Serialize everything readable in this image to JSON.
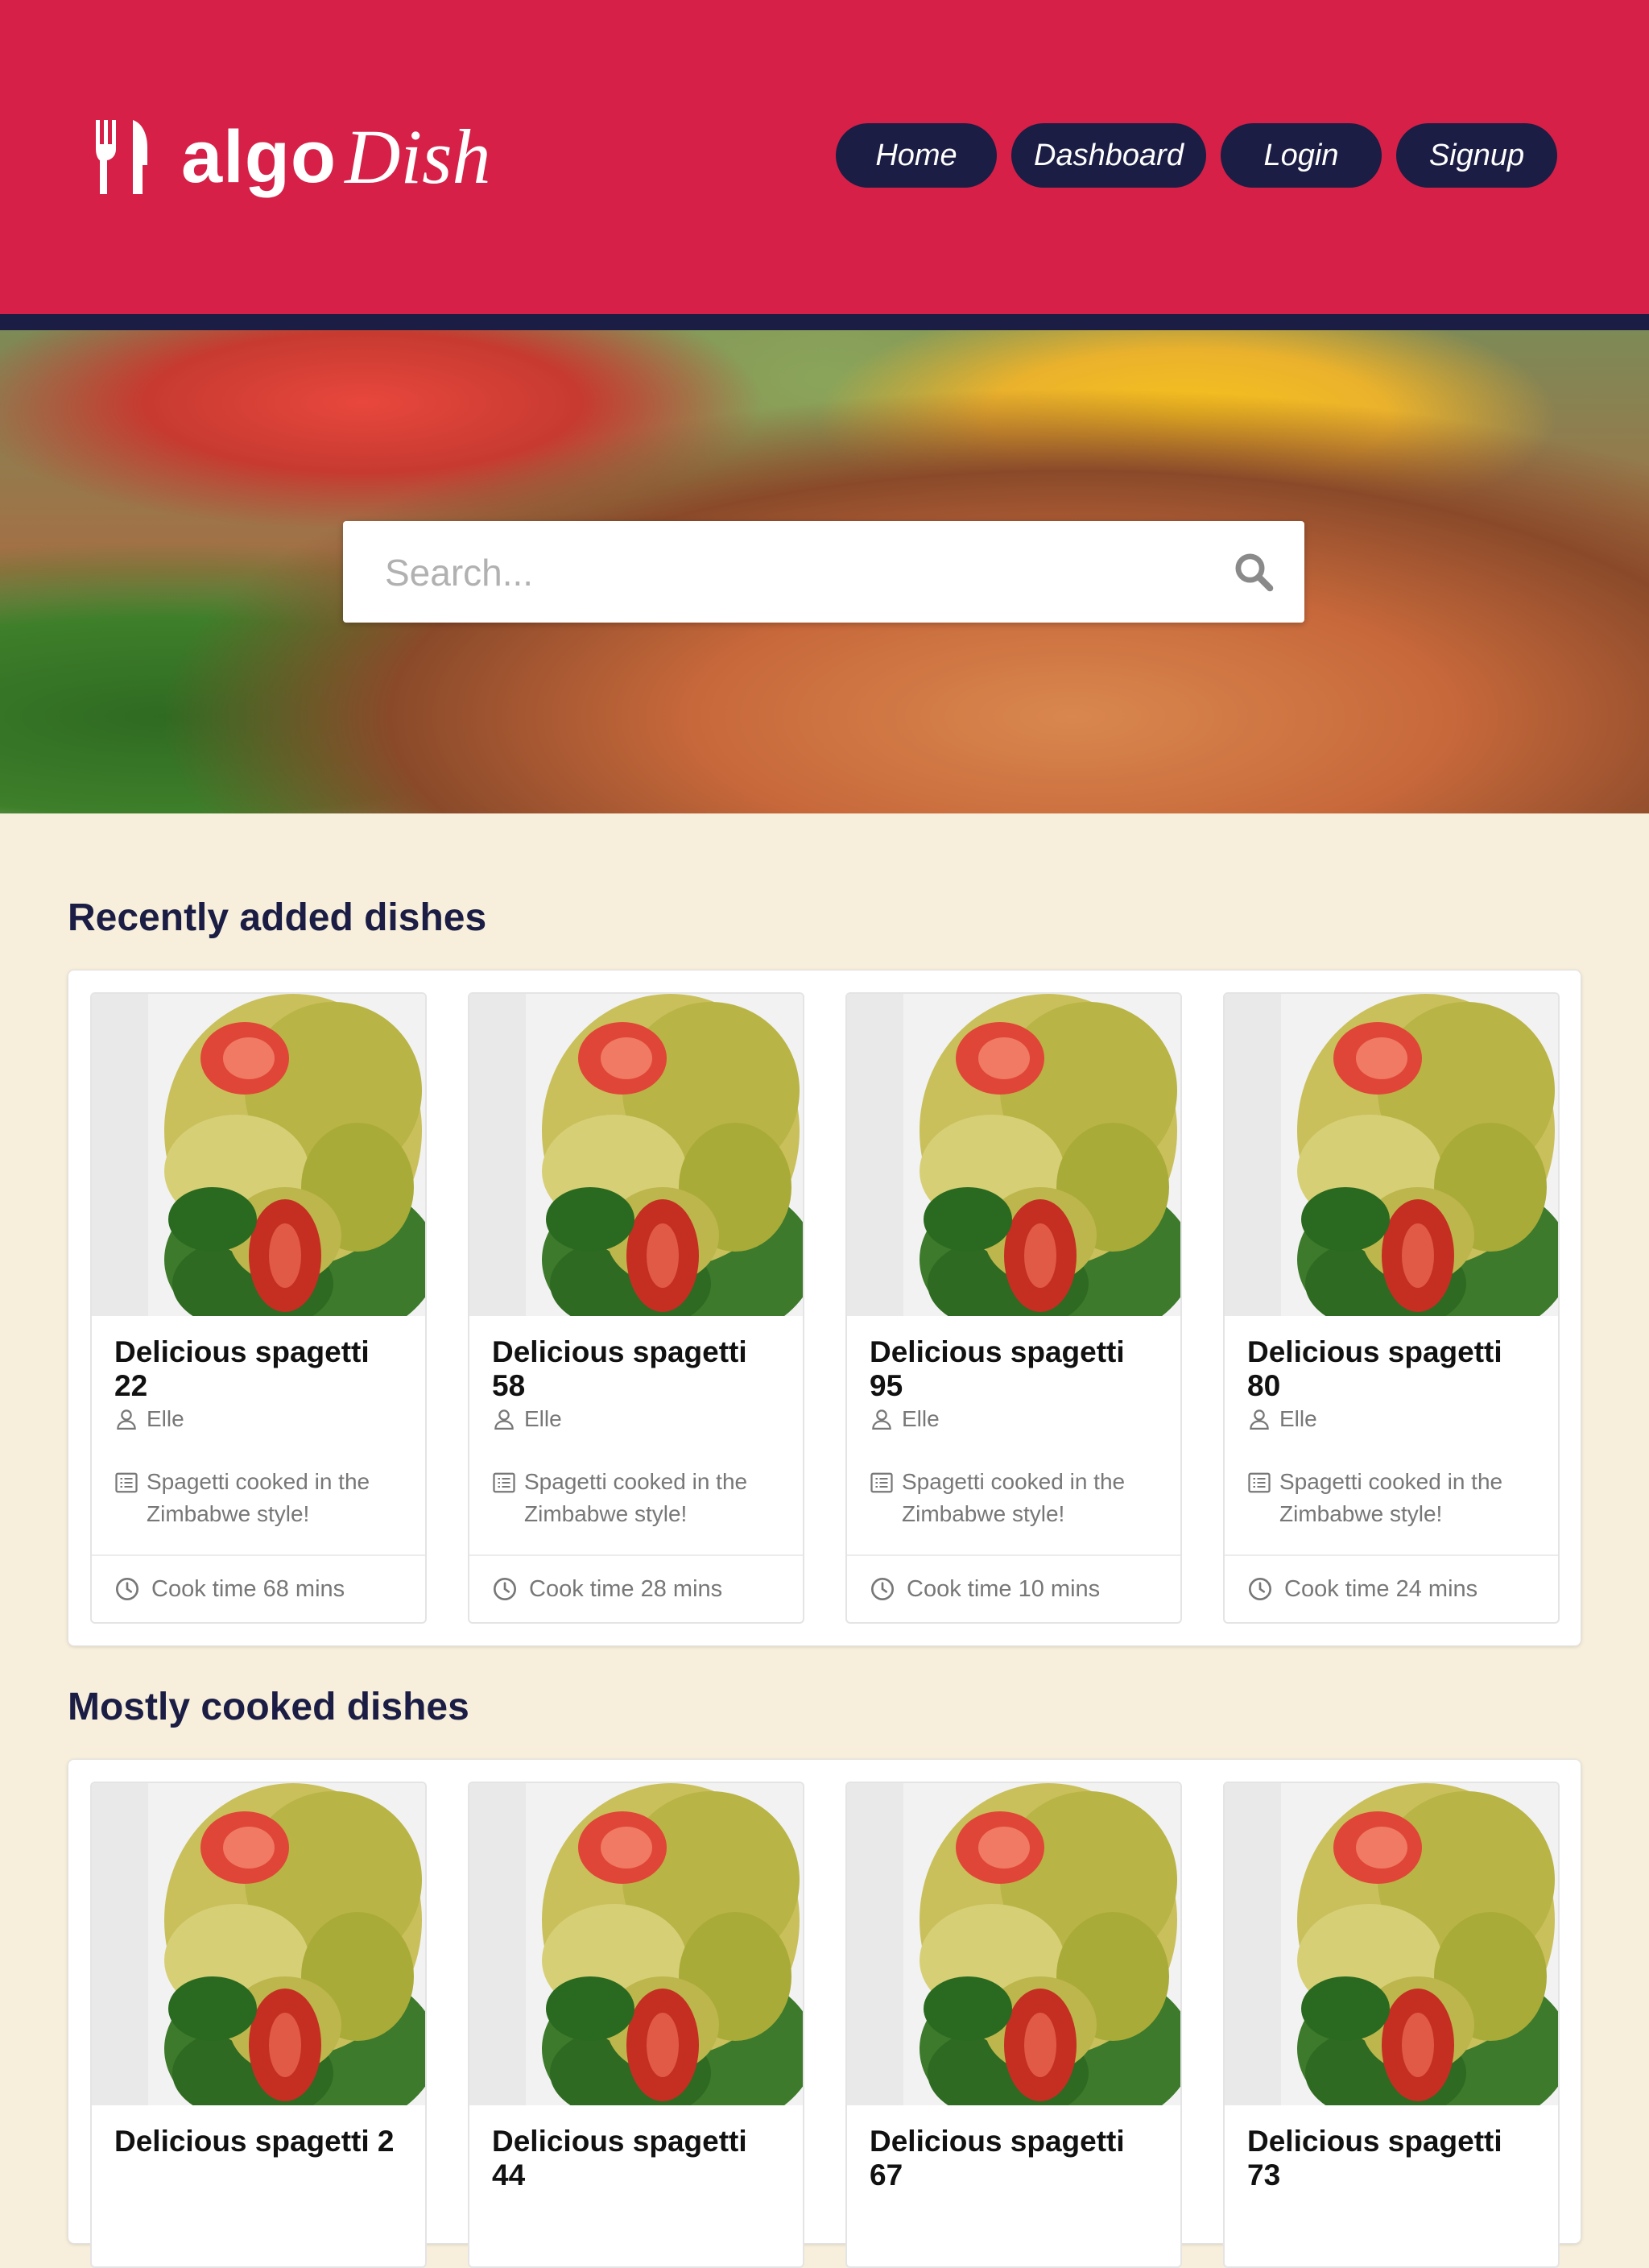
{
  "brand": {
    "algo": "algo",
    "dish": "Dish"
  },
  "nav": [
    {
      "label": "Home"
    },
    {
      "label": "Dashboard"
    },
    {
      "label": "Login"
    },
    {
      "label": "Signup"
    }
  ],
  "search": {
    "placeholder": "Search..."
  },
  "colors": {
    "header": "#d62048",
    "navy": "#1b1d44",
    "background": "#f7efdc"
  },
  "sections": [
    {
      "title": "Recently added dishes",
      "cards": [
        {
          "title": "Delicious spagetti 22",
          "author": "Elle",
          "description": "Spagetti cooked in the Zimbabwe style!",
          "cook_time": "Cook time 68 mins"
        },
        {
          "title": "Delicious spagetti 58",
          "author": "Elle",
          "description": "Spagetti cooked in the Zimbabwe style!",
          "cook_time": "Cook time 28 mins"
        },
        {
          "title": "Delicious spagetti 95",
          "author": "Elle",
          "description": "Spagetti cooked in the Zimbabwe style!",
          "cook_time": "Cook time 10 mins"
        },
        {
          "title": "Delicious spagetti 80",
          "author": "Elle",
          "description": "Spagetti cooked in the Zimbabwe style!",
          "cook_time": "Cook time 24 mins"
        }
      ]
    },
    {
      "title": "Mostly cooked dishes",
      "cards": [
        {
          "title": "Delicious spagetti 2"
        },
        {
          "title": "Delicious spagetti 44"
        },
        {
          "title": "Delicious spagetti 67"
        },
        {
          "title": "Delicious spagetti 73"
        }
      ]
    }
  ]
}
